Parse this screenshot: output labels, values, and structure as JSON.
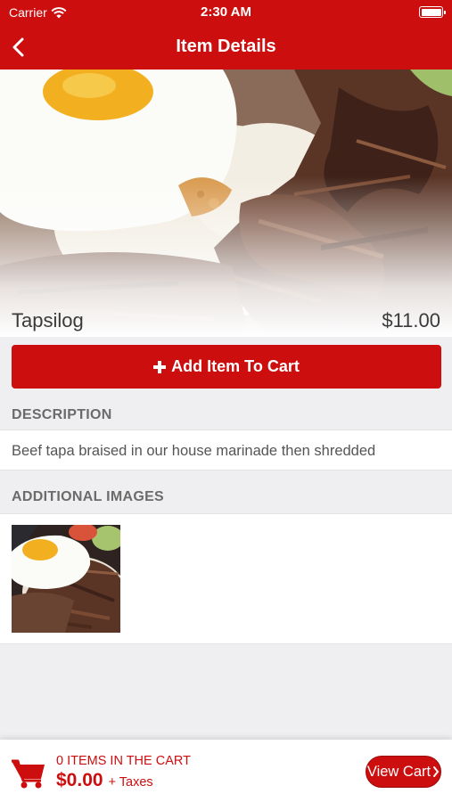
{
  "status_bar": {
    "carrier": "Carrier",
    "time": "2:30 AM"
  },
  "nav": {
    "title": "Item Details",
    "back_icon": "chevron-left-icon"
  },
  "item": {
    "name": "Tapsilog",
    "price": "$11.00",
    "hero_image": "tapsilog-food-photo"
  },
  "actions": {
    "add_icon": "plus-icon",
    "add_label": "Add Item To Cart"
  },
  "description": {
    "heading": "DESCRIPTION",
    "text": "Beef tapa braised in our house marinade then shredded"
  },
  "additional_images": {
    "heading": "ADDITIONAL IMAGES",
    "images": [
      "tapsilog-thumbnail"
    ]
  },
  "cart": {
    "icon": "shopping-cart-icon",
    "count_label": "0 ITEMS IN THE CART",
    "total": "$0.00",
    "taxes_label": "+ Taxes",
    "view_label": "View Cart",
    "view_icon": "chevron-right-icon"
  },
  "colors": {
    "accent": "#cc0e0f",
    "background": "#efeff1",
    "section_heading": "#6b6b6b"
  }
}
